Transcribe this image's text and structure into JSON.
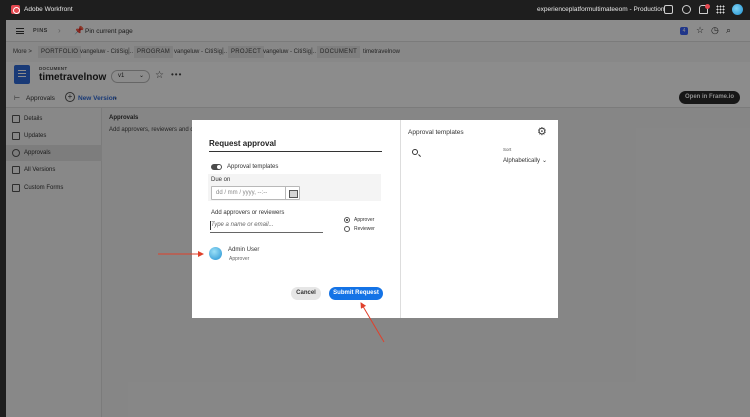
{
  "titlebar": {
    "app_title": "Adobe Workfront",
    "environment": "experienceplatformultimateeom - Production"
  },
  "topnav": {
    "pins_label": "PINS",
    "pin_current_page": "Pin current page",
    "notification_count": "4"
  },
  "breadcrumb": {
    "more": "More >",
    "portfolio_tag": "PORTFOLIO",
    "portfolio_name": "vangeluw - CitiSig...",
    "program_tag": "PROGRAM",
    "program_name": "vangeluw - CitiSig...",
    "project_tag": "PROJECT",
    "project_name": "vangeluw - CitiSig...",
    "document_tag": "DOCUMENT",
    "document_name": "timetravelnow"
  },
  "document": {
    "type_label": "DOCUMENT",
    "name": "timetravelnow",
    "version": "v1"
  },
  "toolbar": {
    "approvals": "Approvals",
    "new_version": "New Version",
    "open_in_frame": "Open in Frame.io"
  },
  "sidebar": {
    "items": [
      {
        "label": "Details"
      },
      {
        "label": "Updates"
      },
      {
        "label": "Approvals"
      },
      {
        "label": "All Versions"
      },
      {
        "label": "Custom Forms"
      }
    ]
  },
  "main": {
    "title": "Approvals",
    "description": "Add approvers, reviewers and dea"
  },
  "modal": {
    "title": "Request approval",
    "templates_toggle_label": "Approval templates",
    "due_on_label": "Due on",
    "date_placeholder": "dd / mm / yyyy, --:--",
    "add_label": "Add approvers or reviewers",
    "name_placeholder": "Type a name or email...",
    "radio_approver": "Approver",
    "radio_reviewer": "Reviewer",
    "user_name": "Admin User",
    "user_role": "Approver",
    "cancel": "Cancel",
    "submit": "Submit Request"
  },
  "templates_panel": {
    "title": "Approval templates",
    "sort_label": "Sort",
    "sort_value": "Alphabetically"
  },
  "colors": {
    "accent": "#1473e6",
    "annotation_arrow": "#e0402b",
    "doc_icon": "#2f6bd9"
  }
}
